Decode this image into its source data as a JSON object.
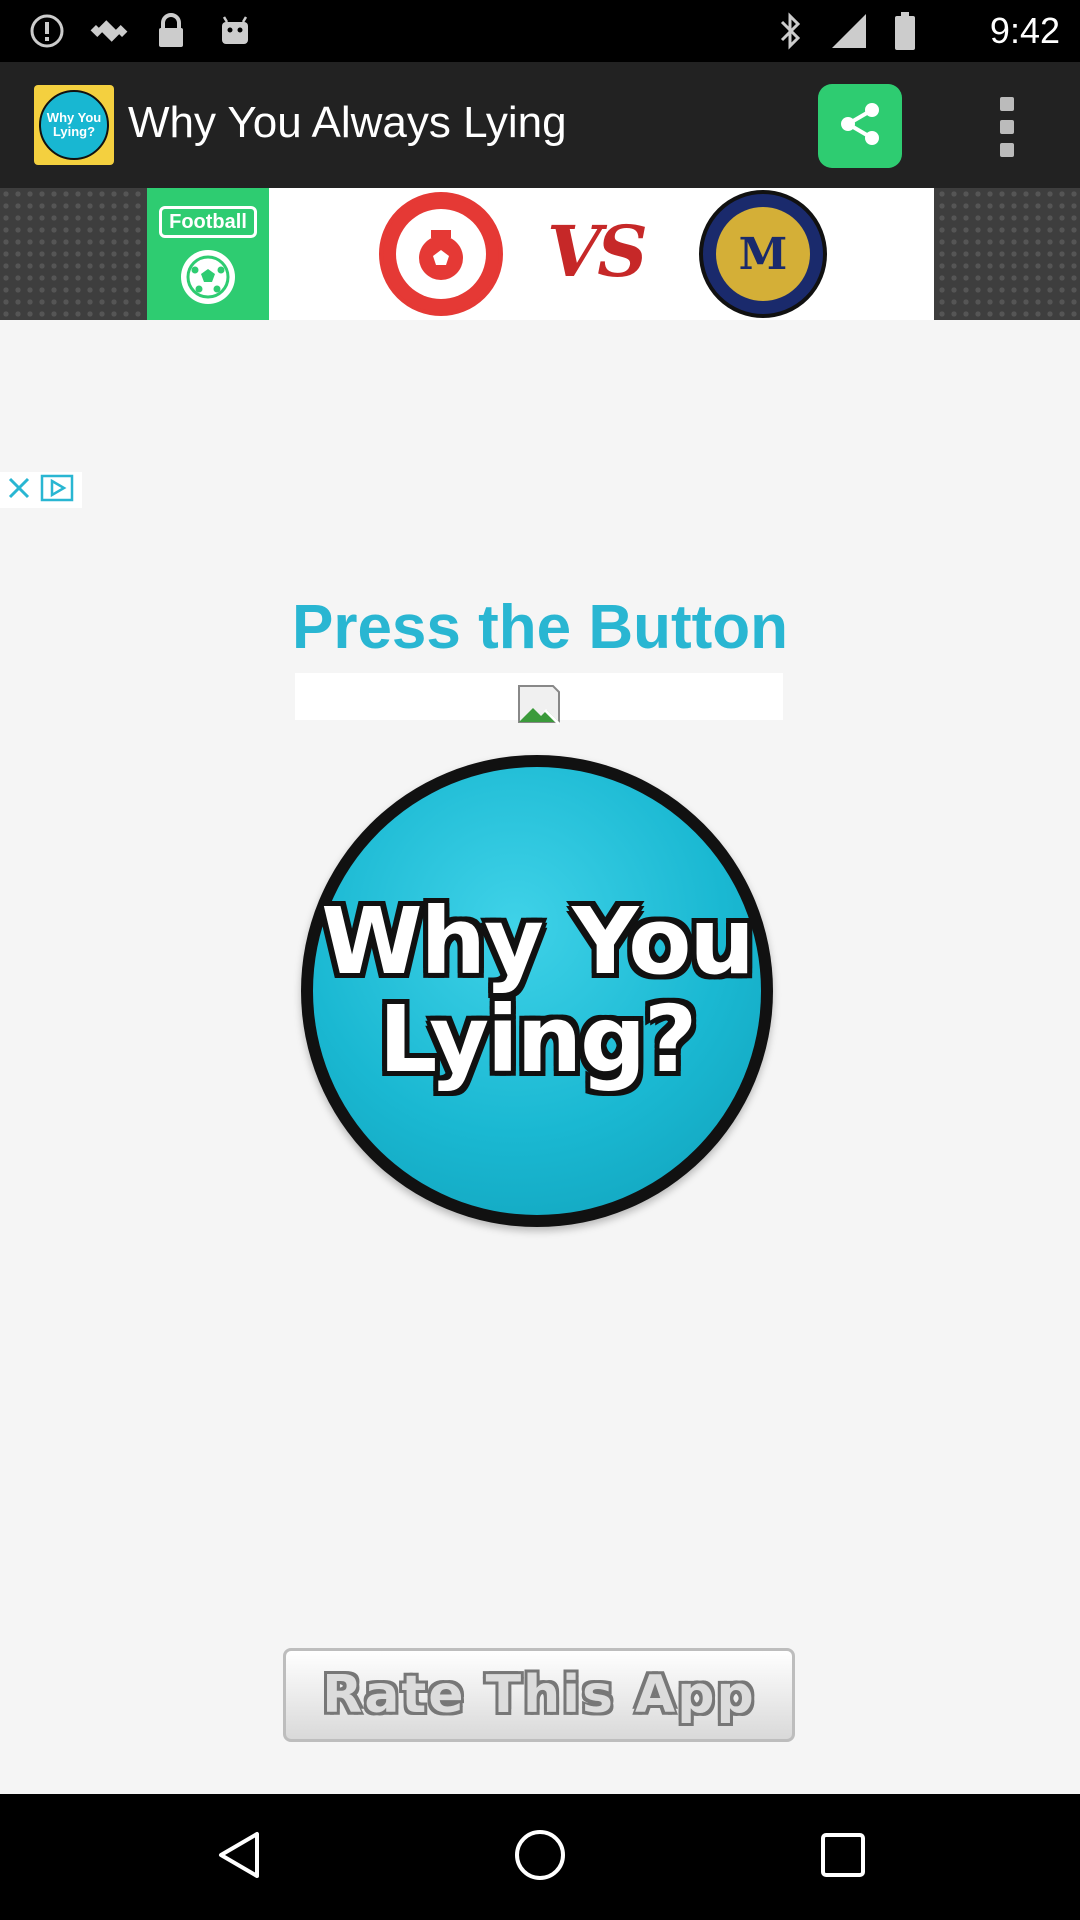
{
  "status_bar": {
    "time": "9:42",
    "left_icons": [
      "alert-icon",
      "fake-gps-icon",
      "lock-icon",
      "android-icon"
    ],
    "right_icons": [
      "bluetooth-icon",
      "signal-icon",
      "battery-icon"
    ]
  },
  "app_bar": {
    "title": "Why You Always Lying",
    "logo_text": "Why You Lying?",
    "share_icon": "share-icon",
    "menu_icon": "overflow-menu-icon",
    "share_color": "#2ecc71"
  },
  "ad": {
    "football_label": "Football",
    "vs_text": "VS",
    "team2_mark": "M"
  },
  "main": {
    "heading": "Press the Button",
    "heading_color": "#29b6d2",
    "button_text_line1": "Why You",
    "button_text_line2": "Lying?",
    "rate_label": "Rate This App"
  },
  "nav_bar": {
    "buttons": [
      "back-icon",
      "home-icon",
      "recents-icon"
    ]
  }
}
